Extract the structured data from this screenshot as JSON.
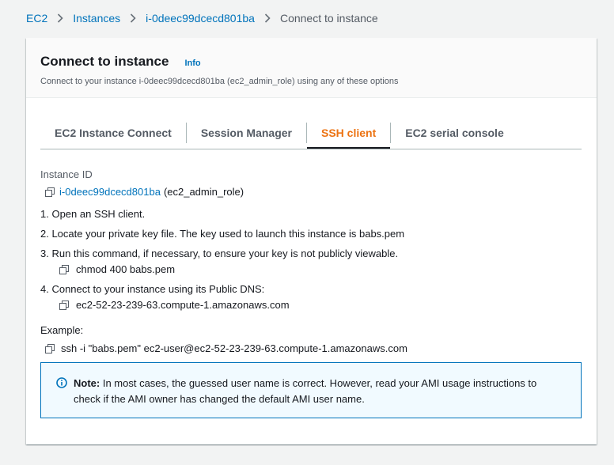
{
  "breadcrumb": {
    "items": [
      "EC2",
      "Instances",
      "i-0deec99dcecd801ba"
    ],
    "current": "Connect to instance"
  },
  "panel": {
    "title": "Connect to instance",
    "info": "Info",
    "description": "Connect to your instance i-0deec99dcecd801ba (ec2_admin_role) using any of these options"
  },
  "tabs": [
    {
      "label": "EC2 Instance Connect"
    },
    {
      "label": "Session Manager"
    },
    {
      "label": "SSH client",
      "active": true
    },
    {
      "label": "EC2 serial console"
    }
  ],
  "content": {
    "instance_id_label": "Instance ID",
    "instance_id": "i-0deec99dcecd801ba",
    "instance_role": "(ec2_admin_role)",
    "steps": [
      "1. Open an SSH client.",
      "2. Locate your private key file. The key used to launch this instance is babs.pem",
      "3. Run this command, if necessary, to ensure your key is not publicly viewable.",
      "4. Connect to your instance using its Public DNS:"
    ],
    "chmod_command": "chmod 400 babs.pem",
    "public_dns": "ec2-52-23-239-63.compute-1.amazonaws.com",
    "example_label": "Example:",
    "ssh_command": "ssh -i \"babs.pem\" ec2-user@ec2-52-23-239-63.compute-1.amazonaws.com"
  },
  "alert": {
    "bold": "Note:",
    "text": " In most cases, the guessed user name is correct. However, read your AMI usage instructions to check if the AMI owner has changed the default AMI user name."
  },
  "colors": {
    "link": "#0073bb",
    "active_tab": "#ec7211",
    "alert_bg": "#f1faff",
    "alert_border": "#0073bb"
  },
  "icons": {
    "copy": "copy-icon",
    "separator": "chevron-right-icon",
    "info": "info-circle-icon"
  }
}
